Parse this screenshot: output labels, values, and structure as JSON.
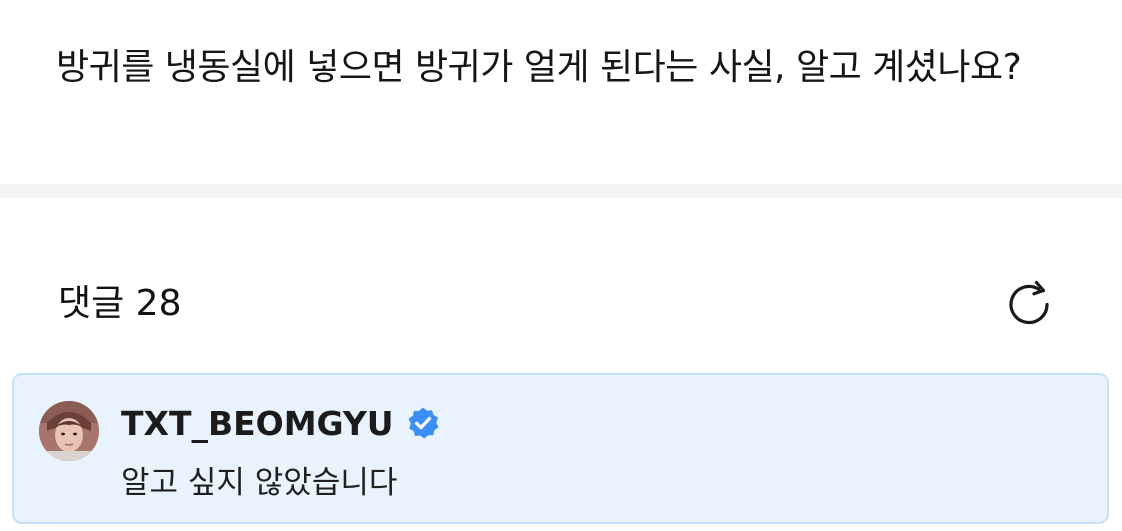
{
  "post": {
    "text": "방귀를 냉동실에 넣으면 방귀가 얼게 된다는 사실, 알고 계셨나요?"
  },
  "comments": {
    "title": "댓글 28",
    "refresh_icon": "refresh-icon"
  },
  "comment": {
    "author": "TXT_BEOMGYU",
    "verified_icon": "verified-badge-icon",
    "verified_color": "#3b8ef3",
    "text": "알고 싶지 않았습니다",
    "card_background": "#e9f3fd",
    "card_border": "#c7e0f8"
  }
}
